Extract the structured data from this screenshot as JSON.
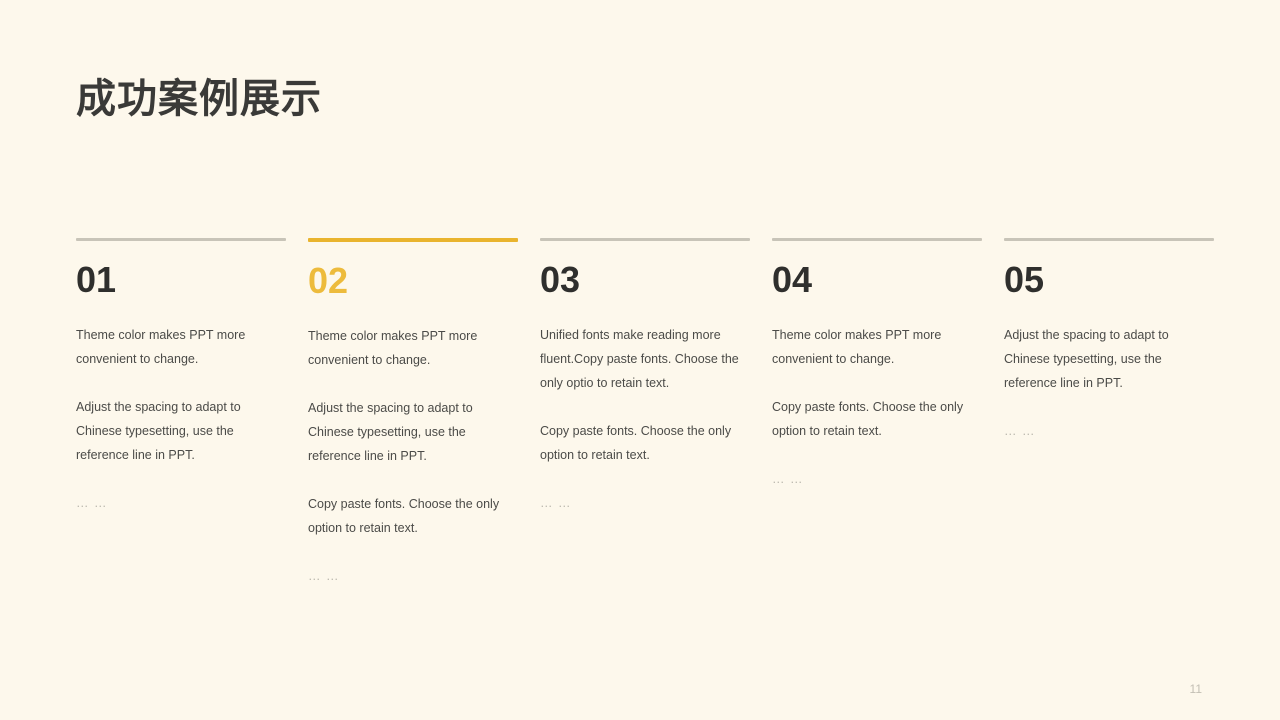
{
  "slide": {
    "title": "成功案例展示",
    "page_number": "11",
    "background_color": "#fdf8ec",
    "accent_color": "#e9b42e",
    "rule_color": "#c8c4b8",
    "text_color": "#4b4b48",
    "number_color": "#2f2f2d"
  },
  "columns": [
    {
      "number": "01",
      "accent": false,
      "paragraphs": [
        "Theme color makes PPT more convenient to change.",
        "Adjust the spacing to adapt to Chinese typesetting, use the reference line in PPT.",
        "… …"
      ]
    },
    {
      "number": "02",
      "accent": true,
      "paragraphs": [
        "Theme color makes PPT more convenient to change.",
        "Adjust the spacing to adapt to Chinese typesetting, use the reference line in PPT.",
        "Copy paste  fonts. Choose the only option to retain text.",
        "… …"
      ]
    },
    {
      "number": "03",
      "accent": false,
      "paragraphs": [
        "Unified fonts make reading more fluent.Copy paste fonts. Choose the only optio to retain text.",
        "Copy paste  fonts. Choose the only option to retain text.",
        "… …"
      ]
    },
    {
      "number": "04",
      "accent": false,
      "paragraphs": [
        "Theme color makes PPT more convenient to change.",
        "Copy paste  fonts. Choose the only option to retain text.",
        "… …"
      ]
    },
    {
      "number": "05",
      "accent": false,
      "paragraphs": [
        "Adjust the spacing to adapt to Chinese typesetting, use the reference line in PPT.",
        "… …"
      ]
    }
  ]
}
